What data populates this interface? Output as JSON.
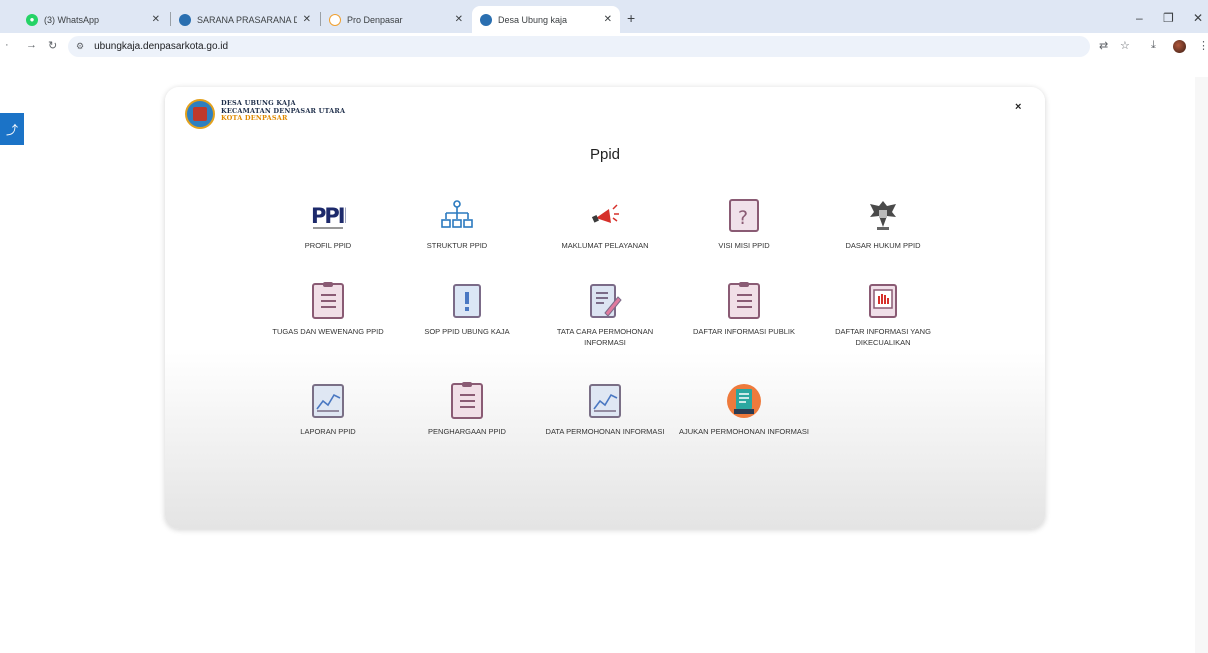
{
  "browser": {
    "tabs": [
      {
        "title": "(3) WhatsApp",
        "icon": "whatsapp-icon",
        "color": "#25d366"
      },
      {
        "title": "SARANA PRASARANA DAN INF",
        "icon": "site-logo-icon",
        "color": "#2a6fb0"
      },
      {
        "title": "Pro Denpasar",
        "icon": "pro-denpasar-icon",
        "color": "#f0a030"
      },
      {
        "title": "Desa Ubung kaja",
        "icon": "site-logo-icon",
        "color": "#2a6fb0"
      }
    ],
    "url": "ubungkaja.denpasarkota.go.id"
  },
  "modal": {
    "org_line1": "DESA UBUNG KAJA",
    "org_line2": "KECAMATAN DENPASAR UTARA",
    "org_line3": "KOTA DENPASAR",
    "title": "Ppid",
    "close": "×",
    "items": [
      {
        "label": "PROFIL PPID",
        "icon": "ppid-logo-icon"
      },
      {
        "label": "STRUKTUR PPID",
        "icon": "org-structure-icon"
      },
      {
        "label": "MAKLUMAT PELAYANAN",
        "icon": "megaphone-icon"
      },
      {
        "label": "VISI MISI PPID",
        "icon": "question-document-icon"
      },
      {
        "label": "DASAR HUKUM PPID",
        "icon": "garuda-emblem-icon"
      },
      {
        "label": "TUGAS DAN WEWENANG PPID",
        "icon": "clipboard-icon"
      },
      {
        "label": "SOP PPID UBUNG KAJA",
        "icon": "exclamation-document-icon"
      },
      {
        "label": "TATA CARA PERMOHONAN INFORMASI",
        "icon": "document-pen-icon"
      },
      {
        "label": "DAFTAR INFORMASI PUBLIK",
        "icon": "clipboard-icon"
      },
      {
        "label": "DAFTAR INFORMASI YANG DIKECUALIKAN",
        "icon": "hand-stop-document-icon"
      },
      {
        "label": "LAPORAN PPID",
        "icon": "chart-report-icon"
      },
      {
        "label": "PENGHARGAAN PPID",
        "icon": "clipboard-icon"
      },
      {
        "label": "DATA PERMOHONAN INFORMASI",
        "icon": "chart-report-icon"
      },
      {
        "label": "AJUKAN PERMOHONAN INFORMASI",
        "icon": "request-form-icon"
      }
    ]
  }
}
